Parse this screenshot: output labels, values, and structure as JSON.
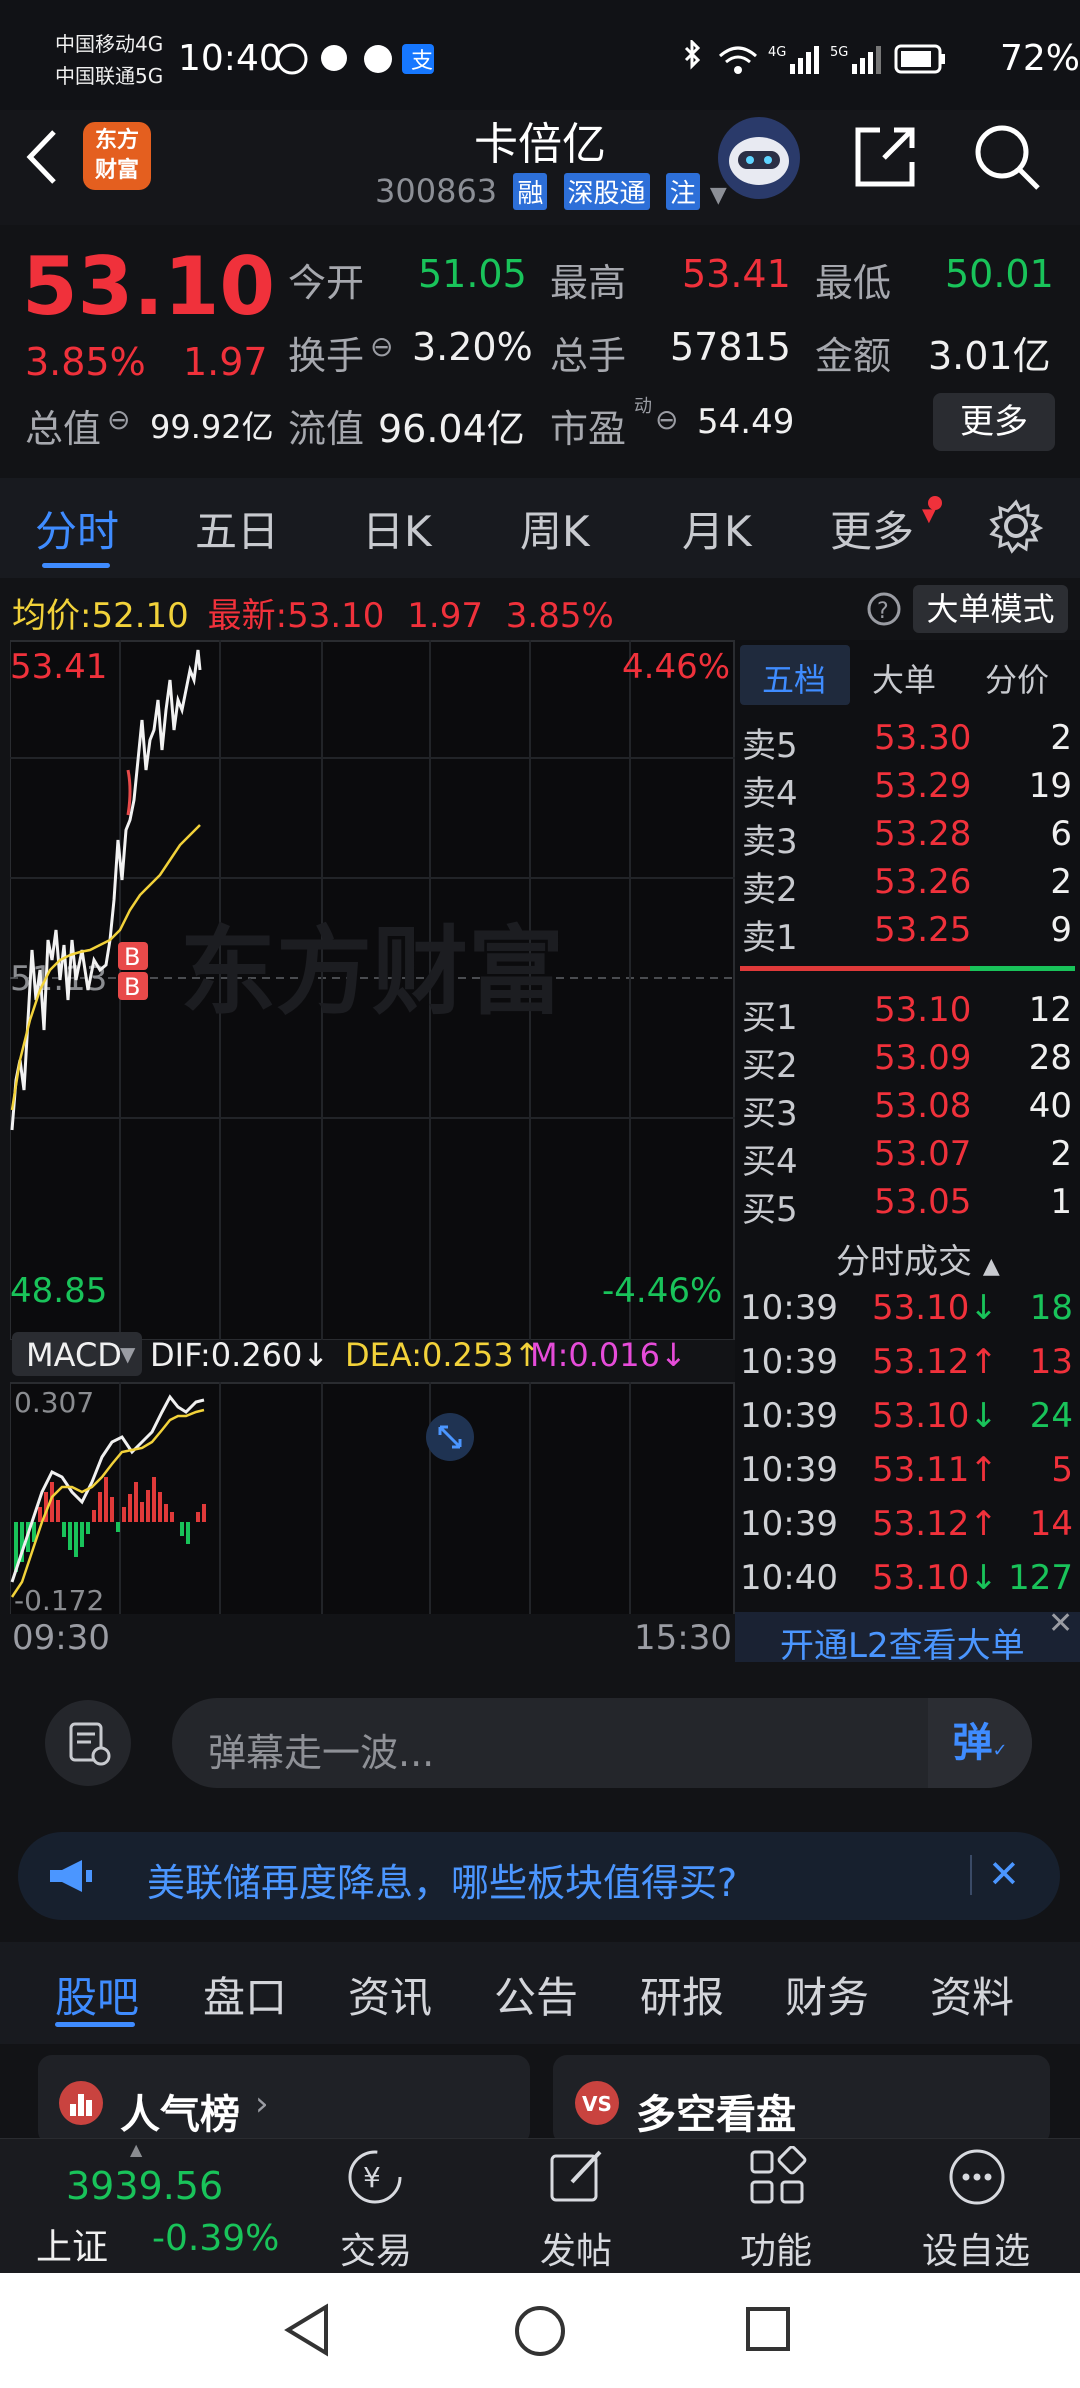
{
  "status_bar": {
    "carrier1": "中国移动4G",
    "carrier2": "中国联通5G",
    "time": "10:40",
    "net1": "4G",
    "net2": "5G",
    "battery": "72%"
  },
  "header": {
    "logo_text_line1": "东方",
    "logo_text_line2": "财富",
    "stock_name": "卡倍亿",
    "stock_code": "300863",
    "tags": [
      "融",
      "深股通",
      "注"
    ]
  },
  "quote": {
    "price": "53.10",
    "change_pct": "3.85%",
    "change_amt": "1.97",
    "open_label": "今开",
    "open": "51.05",
    "high_label": "最高",
    "high": "53.41",
    "low_label": "最低",
    "low": "50.01",
    "turnover_label": "换手",
    "turnover": "3.20%",
    "volume_label": "总手",
    "volume": "57815",
    "amount_label": "金额",
    "amount": "3.01亿",
    "mktcap_label": "总值",
    "mktcap": "99.92亿",
    "float_label": "流值",
    "float": "96.04亿",
    "pe_label": "市盈",
    "pe_sup": "动",
    "pe": "54.49",
    "more": "更多"
  },
  "chart_tabs": [
    "分时",
    "五日",
    "日K",
    "周K",
    "月K",
    "更多"
  ],
  "avg_row": {
    "avg_label": "均价:",
    "avg": "52.10",
    "latest_label": "最新:",
    "latest": "53.10",
    "chg": "1.97",
    "pct": "3.85%",
    "big_order_mode": "大单模式"
  },
  "chart": {
    "top_price": "53.41",
    "top_pct": "4.46%",
    "mid_price": "51.13",
    "bottom_price": "48.85",
    "bottom_pct": "-4.46%",
    "watermark": "东方财富",
    "time_start": "09:30",
    "time_end": "15:30",
    "marker": "B"
  },
  "macd": {
    "name": "MACD",
    "dif": "DIF:0.260",
    "dea": "DEA:0.253",
    "m": "M:0.016",
    "top": "0.307",
    "bottom": "-0.172"
  },
  "order_book": {
    "tabs": [
      "五档",
      "大单",
      "分价"
    ],
    "asks": [
      {
        "label": "卖5",
        "price": "53.30",
        "vol": "2"
      },
      {
        "label": "卖4",
        "price": "53.29",
        "vol": "19"
      },
      {
        "label": "卖3",
        "price": "53.28",
        "vol": "6"
      },
      {
        "label": "卖2",
        "price": "53.26",
        "vol": "2"
      },
      {
        "label": "卖1",
        "price": "53.25",
        "vol": "9"
      }
    ],
    "bids": [
      {
        "label": "买1",
        "price": "53.10",
        "vol": "12"
      },
      {
        "label": "买2",
        "price": "53.09",
        "vol": "28"
      },
      {
        "label": "买3",
        "price": "53.08",
        "vol": "40"
      },
      {
        "label": "买4",
        "price": "53.07",
        "vol": "2"
      },
      {
        "label": "买5",
        "price": "53.05",
        "vol": "1"
      }
    ],
    "trades_title": "分时成交",
    "trades": [
      {
        "time": "10:39",
        "price": "53.10",
        "dir": "↓",
        "vol": "18",
        "up": false
      },
      {
        "time": "10:39",
        "price": "53.12",
        "dir": "↑",
        "vol": "13",
        "up": true
      },
      {
        "time": "10:39",
        "price": "53.10",
        "dir": "↓",
        "vol": "24",
        "up": false
      },
      {
        "time": "10:39",
        "price": "53.11",
        "dir": "↑",
        "vol": "5",
        "up": true
      },
      {
        "time": "10:39",
        "price": "53.12",
        "dir": "↑",
        "vol": "14",
        "up": true
      },
      {
        "time": "10:40",
        "price": "53.10",
        "dir": "↓",
        "vol": "127",
        "up": false
      }
    ],
    "l2_link": "开通L2查看大单"
  },
  "danmu": {
    "placeholder": "弹幕走一波...",
    "button": "弹"
  },
  "news_banner": "美联储再度降息，哪些板块值得买?",
  "bottom_tabs": [
    "股吧",
    "盘口",
    "资讯",
    "公告",
    "研报",
    "财务",
    "资料"
  ],
  "cards": [
    "人气榜",
    "多空看盘"
  ],
  "bottom_nav": {
    "index_value": "3939.56",
    "index_name": "上证",
    "index_pct": "-0.39%",
    "items": [
      "交易",
      "发帖",
      "功能",
      "设自选"
    ]
  }
}
